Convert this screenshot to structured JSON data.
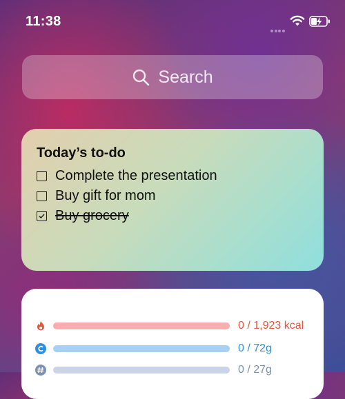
{
  "status_bar": {
    "time": "11:38"
  },
  "search": {
    "placeholder": "Search",
    "icon": "search-icon"
  },
  "todo": {
    "title": "Today’s to-do",
    "items": [
      {
        "label": "Complete the presentation",
        "checked": false
      },
      {
        "label": "Buy gift for mom",
        "checked": false
      },
      {
        "label": "Buy grocery",
        "checked": true
      }
    ]
  },
  "nutrition": {
    "rows": [
      {
        "icon": "flame-icon",
        "value": "0 / 1,923 kcal",
        "color": "#e4553f",
        "bar_color": "#f6aeae",
        "progress": 0
      },
      {
        "icon": "carbs-icon",
        "value": "0 / 72g",
        "color": "#2f8fdc",
        "bar_color": "#a9d0f3",
        "progress": 0
      },
      {
        "icon": "fat-icon",
        "value": "0 / 27g",
        "color": "#7d8fb3",
        "bar_color": "#cbd4e6",
        "progress": 0
      }
    ]
  }
}
